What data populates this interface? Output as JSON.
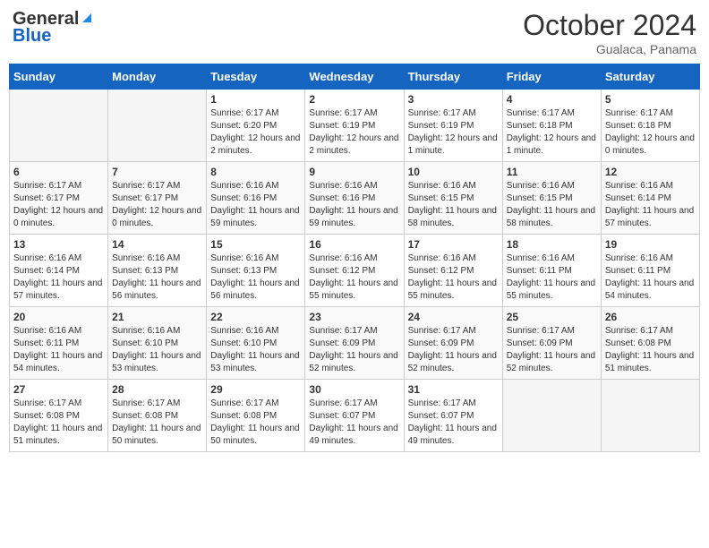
{
  "header": {
    "logo_line1": "General",
    "logo_line2": "Blue",
    "month": "October 2024",
    "location": "Gualaca, Panama"
  },
  "days_of_week": [
    "Sunday",
    "Monday",
    "Tuesday",
    "Wednesday",
    "Thursday",
    "Friday",
    "Saturday"
  ],
  "weeks": [
    [
      {
        "day": "",
        "info": ""
      },
      {
        "day": "",
        "info": ""
      },
      {
        "day": "1",
        "info": "Sunrise: 6:17 AM\nSunset: 6:20 PM\nDaylight: 12 hours and 2 minutes."
      },
      {
        "day": "2",
        "info": "Sunrise: 6:17 AM\nSunset: 6:19 PM\nDaylight: 12 hours and 2 minutes."
      },
      {
        "day": "3",
        "info": "Sunrise: 6:17 AM\nSunset: 6:19 PM\nDaylight: 12 hours and 1 minute."
      },
      {
        "day": "4",
        "info": "Sunrise: 6:17 AM\nSunset: 6:18 PM\nDaylight: 12 hours and 1 minute."
      },
      {
        "day": "5",
        "info": "Sunrise: 6:17 AM\nSunset: 6:18 PM\nDaylight: 12 hours and 0 minutes."
      }
    ],
    [
      {
        "day": "6",
        "info": "Sunrise: 6:17 AM\nSunset: 6:17 PM\nDaylight: 12 hours and 0 minutes."
      },
      {
        "day": "7",
        "info": "Sunrise: 6:17 AM\nSunset: 6:17 PM\nDaylight: 12 hours and 0 minutes."
      },
      {
        "day": "8",
        "info": "Sunrise: 6:16 AM\nSunset: 6:16 PM\nDaylight: 11 hours and 59 minutes."
      },
      {
        "day": "9",
        "info": "Sunrise: 6:16 AM\nSunset: 6:16 PM\nDaylight: 11 hours and 59 minutes."
      },
      {
        "day": "10",
        "info": "Sunrise: 6:16 AM\nSunset: 6:15 PM\nDaylight: 11 hours and 58 minutes."
      },
      {
        "day": "11",
        "info": "Sunrise: 6:16 AM\nSunset: 6:15 PM\nDaylight: 11 hours and 58 minutes."
      },
      {
        "day": "12",
        "info": "Sunrise: 6:16 AM\nSunset: 6:14 PM\nDaylight: 11 hours and 57 minutes."
      }
    ],
    [
      {
        "day": "13",
        "info": "Sunrise: 6:16 AM\nSunset: 6:14 PM\nDaylight: 11 hours and 57 minutes."
      },
      {
        "day": "14",
        "info": "Sunrise: 6:16 AM\nSunset: 6:13 PM\nDaylight: 11 hours and 56 minutes."
      },
      {
        "day": "15",
        "info": "Sunrise: 6:16 AM\nSunset: 6:13 PM\nDaylight: 11 hours and 56 minutes."
      },
      {
        "day": "16",
        "info": "Sunrise: 6:16 AM\nSunset: 6:12 PM\nDaylight: 11 hours and 55 minutes."
      },
      {
        "day": "17",
        "info": "Sunrise: 6:16 AM\nSunset: 6:12 PM\nDaylight: 11 hours and 55 minutes."
      },
      {
        "day": "18",
        "info": "Sunrise: 6:16 AM\nSunset: 6:11 PM\nDaylight: 11 hours and 55 minutes."
      },
      {
        "day": "19",
        "info": "Sunrise: 6:16 AM\nSunset: 6:11 PM\nDaylight: 11 hours and 54 minutes."
      }
    ],
    [
      {
        "day": "20",
        "info": "Sunrise: 6:16 AM\nSunset: 6:11 PM\nDaylight: 11 hours and 54 minutes."
      },
      {
        "day": "21",
        "info": "Sunrise: 6:16 AM\nSunset: 6:10 PM\nDaylight: 11 hours and 53 minutes."
      },
      {
        "day": "22",
        "info": "Sunrise: 6:16 AM\nSunset: 6:10 PM\nDaylight: 11 hours and 53 minutes."
      },
      {
        "day": "23",
        "info": "Sunrise: 6:17 AM\nSunset: 6:09 PM\nDaylight: 11 hours and 52 minutes."
      },
      {
        "day": "24",
        "info": "Sunrise: 6:17 AM\nSunset: 6:09 PM\nDaylight: 11 hours and 52 minutes."
      },
      {
        "day": "25",
        "info": "Sunrise: 6:17 AM\nSunset: 6:09 PM\nDaylight: 11 hours and 52 minutes."
      },
      {
        "day": "26",
        "info": "Sunrise: 6:17 AM\nSunset: 6:08 PM\nDaylight: 11 hours and 51 minutes."
      }
    ],
    [
      {
        "day": "27",
        "info": "Sunrise: 6:17 AM\nSunset: 6:08 PM\nDaylight: 11 hours and 51 minutes."
      },
      {
        "day": "28",
        "info": "Sunrise: 6:17 AM\nSunset: 6:08 PM\nDaylight: 11 hours and 50 minutes."
      },
      {
        "day": "29",
        "info": "Sunrise: 6:17 AM\nSunset: 6:08 PM\nDaylight: 11 hours and 50 minutes."
      },
      {
        "day": "30",
        "info": "Sunrise: 6:17 AM\nSunset: 6:07 PM\nDaylight: 11 hours and 49 minutes."
      },
      {
        "day": "31",
        "info": "Sunrise: 6:17 AM\nSunset: 6:07 PM\nDaylight: 11 hours and 49 minutes."
      },
      {
        "day": "",
        "info": ""
      },
      {
        "day": "",
        "info": ""
      }
    ]
  ]
}
